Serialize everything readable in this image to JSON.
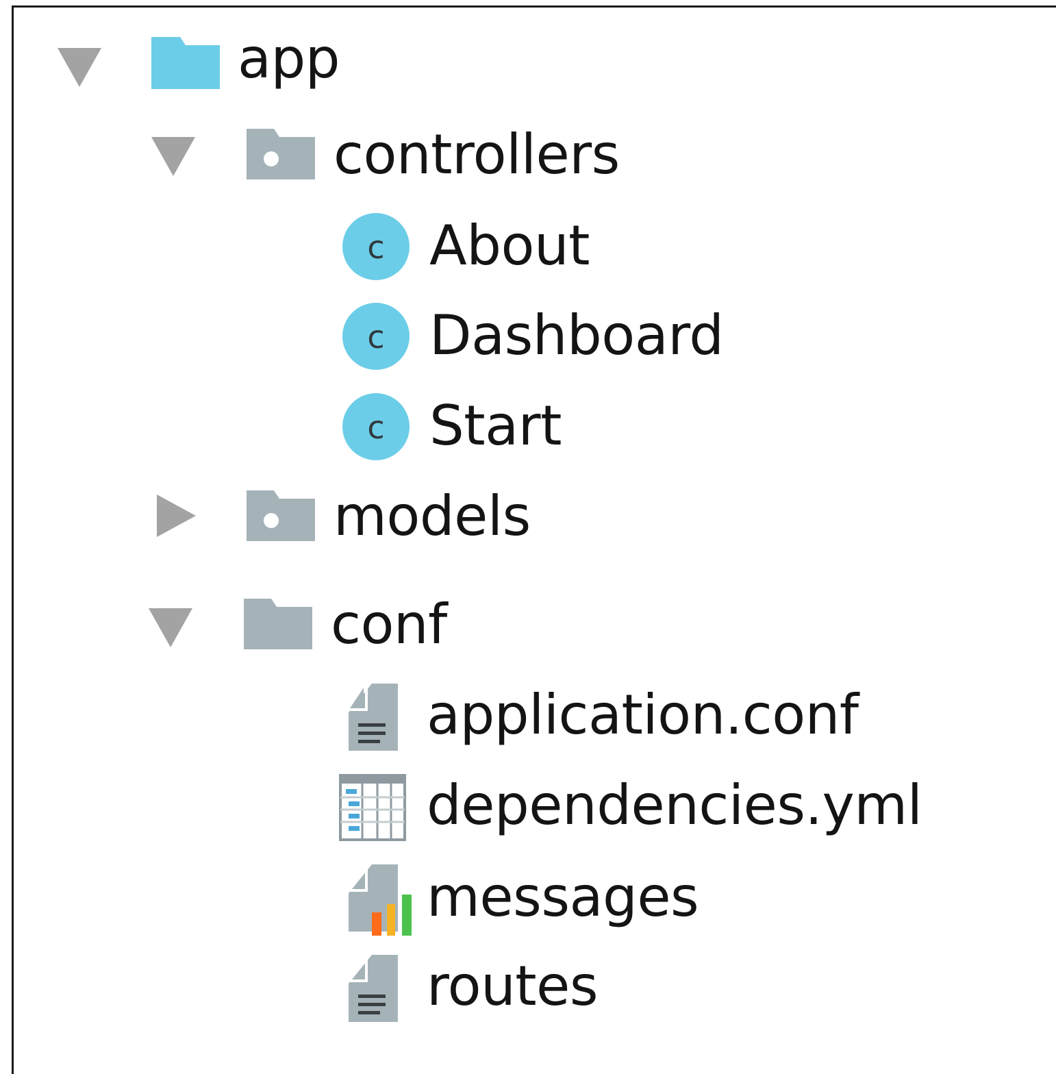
{
  "tree": {
    "root": {
      "label": "app",
      "icon": "folder-icon",
      "expanded": true,
      "color": "#6ccde8"
    },
    "controllers": {
      "label": "controllers",
      "icon": "package-folder-icon",
      "expanded": true,
      "children": [
        {
          "label": "About",
          "icon": "class-icon",
          "glyph": "c"
        },
        {
          "label": "Dashboard",
          "icon": "class-icon",
          "glyph": "c"
        },
        {
          "label": "Start",
          "icon": "class-icon",
          "glyph": "c"
        }
      ]
    },
    "models": {
      "label": "models",
      "icon": "package-folder-icon",
      "expanded": false
    },
    "conf": {
      "label": "conf",
      "icon": "folder-icon",
      "expanded": true,
      "children": [
        {
          "label": "application.conf",
          "icon": "text-file-icon"
        },
        {
          "label": "dependencies.yml",
          "icon": "yaml-file-icon"
        },
        {
          "label": "messages",
          "icon": "properties-file-icon"
        },
        {
          "label": "routes",
          "icon": "text-file-icon"
        }
      ]
    }
  },
  "colors": {
    "arrow": "#a3a3a3",
    "folder_blue": "#6ccde8",
    "folder_gray": "#a5b3b8",
    "class_circle": "#6ccde8",
    "text": "#141414"
  }
}
